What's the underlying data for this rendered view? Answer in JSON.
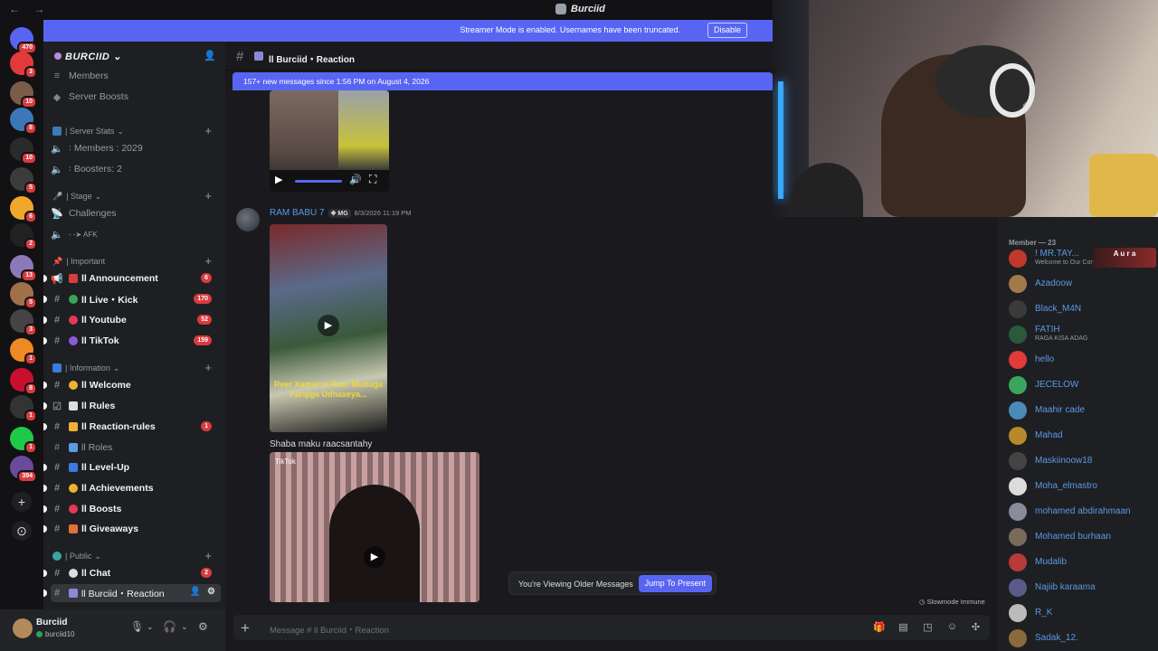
{
  "titlebar": {
    "title": "Burciid",
    "nav": "← →"
  },
  "banner": {
    "text": "Streamer Mode is enabled. Usernames have been truncated.",
    "button": "Disable"
  },
  "servers": [
    {
      "badge": "470",
      "color": "#5865f2"
    },
    {
      "badge": "3",
      "color": "#e23a3a"
    },
    {
      "badge": "10",
      "color": "#7a5c4a"
    },
    {
      "badge": "8",
      "color": "#3c77b8"
    },
    {
      "badge": "10",
      "color": "#2a2a2a"
    },
    {
      "badge": "5",
      "color": "#3b3b3b"
    },
    {
      "badge": "6",
      "color": "#f0a82a"
    },
    {
      "badge": "2",
      "color": "#222"
    },
    {
      "badge": "13",
      "color": "#8c7ab8"
    },
    {
      "badge": "5",
      "color": "#a0704a"
    },
    {
      "badge": "3",
      "color": "#444"
    },
    {
      "badge": "1",
      "color": "#f08a24"
    },
    {
      "badge": "8",
      "color": "#c8102e"
    },
    {
      "badge": "1",
      "color": "#333"
    },
    {
      "badge": "1",
      "color": "#1ec94a"
    },
    {
      "badge": "394",
      "color": "#6a4a9a"
    }
  ],
  "rail_buttons": {
    "add": "+",
    "explore": "⊙"
  },
  "server": {
    "name": "BURCIID"
  },
  "sidebar": {
    "top_items": [
      {
        "label": "Members",
        "icon": "users-icon"
      },
      {
        "label": "Server Boosts",
        "icon": "boost-icon"
      }
    ],
    "categories": {
      "stats": "| Server Stats",
      "stage": "| Stage",
      "important": "| Important",
      "information": "| Information",
      "public": "| Public"
    },
    "stats": [
      {
        "label": "꞉ Members : 2029"
      },
      {
        "label": "꞉ Boosters: 2"
      }
    ],
    "stage": [
      {
        "label": "Challenges"
      },
      {
        "label": "- -➤ AFK"
      }
    ],
    "important": [
      {
        "label": "ll Announcement",
        "badge": "6"
      },
      {
        "label": "ll Live・Kick",
        "badge": "170"
      },
      {
        "label": "ll Youtube",
        "badge": "52"
      },
      {
        "label": "ll TikTok",
        "badge": "159"
      }
    ],
    "information": [
      {
        "label": "ll Welcome",
        "badge": ""
      },
      {
        "label": "ll Rules",
        "badge": ""
      },
      {
        "label": "ll Reaction-rules",
        "badge": "1"
      },
      {
        "label": "ll Roles",
        "badge": ""
      },
      {
        "label": "ll Level-Up",
        "badge": ""
      },
      {
        "label": "ll Achievements",
        "badge": ""
      },
      {
        "label": "ll Boosts",
        "badge": ""
      },
      {
        "label": "ll Giveaways",
        "badge": ""
      }
    ],
    "public": [
      {
        "label": "ll Chat",
        "badge": "2"
      },
      {
        "label": "ll Burciid・Reaction",
        "badge": ""
      }
    ]
  },
  "user": {
    "name": "Burciid",
    "status": "burciid10"
  },
  "chat": {
    "channel": "ll Burciid・Reaction",
    "new_messages": "157+ new messages since 1:56 PM on August 4, 2026",
    "author": "RAM BABU 7",
    "tag": "MG",
    "time": "8/3/2026 11:19 PM",
    "video_caption_text": "Reer Xamar io Reer Muduga Farqiga Udhaxeya...",
    "caption": "Shaba maku raacsantahy",
    "tiktok": "TikTok",
    "older_text": "You're Viewing Older Messages",
    "jump_button": "Jump To Present",
    "slowmode": "Slowmode Immune",
    "placeholder": "Message # ll Burciid・Reaction"
  },
  "members": {
    "header": "Member — 23",
    "list": [
      {
        "name": "! MR.TAY...",
        "sub": "Welcome to Our Communi...",
        "color": "#c0392b",
        "extra": "A u r a"
      },
      {
        "name": "Azadoow",
        "sub": "",
        "color": "#a27a4a",
        "extra": ""
      },
      {
        "name": "Black_M4N",
        "sub": "",
        "color": "#3a3a3a",
        "extra": ""
      },
      {
        "name": "FATIH",
        "sub": "RAGA KISA ADAG",
        "color": "#2a5a3a",
        "extra": ""
      },
      {
        "name": "hello",
        "sub": "",
        "color": "#e23a3a",
        "extra": ""
      },
      {
        "name": "JECELOW",
        "sub": "",
        "color": "#3ba55c",
        "extra": ""
      },
      {
        "name": "Maahir cade",
        "sub": "",
        "color": "#4a8ab8",
        "extra": ""
      },
      {
        "name": "Mahad",
        "sub": "",
        "color": "#b8882a",
        "extra": ""
      },
      {
        "name": "Maskiinoow18",
        "sub": "",
        "color": "#444",
        "extra": ""
      },
      {
        "name": "Moha_elmastro",
        "sub": "",
        "color": "#dcdcdc",
        "extra": ""
      },
      {
        "name": "mohamed abdirahmaan",
        "sub": "",
        "color": "#8a8a9a",
        "extra": ""
      },
      {
        "name": "Mohamed burhaan",
        "sub": "",
        "color": "#7a6a5a",
        "extra": ""
      },
      {
        "name": "Mudalib",
        "sub": "",
        "color": "#b83a3a",
        "extra": ""
      },
      {
        "name": "Najiib karaama",
        "sub": "",
        "color": "#5a5a8a",
        "extra": ""
      },
      {
        "name": "R_K",
        "sub": "",
        "color": "#bbb",
        "extra": ""
      },
      {
        "name": "Sadak_12.",
        "sub": "",
        "color": "#8a6a3a",
        "extra": ""
      }
    ]
  },
  "colors": {
    "accent": "#5865f2",
    "badge": "#d83c3e",
    "link": "#5a9ae6"
  }
}
